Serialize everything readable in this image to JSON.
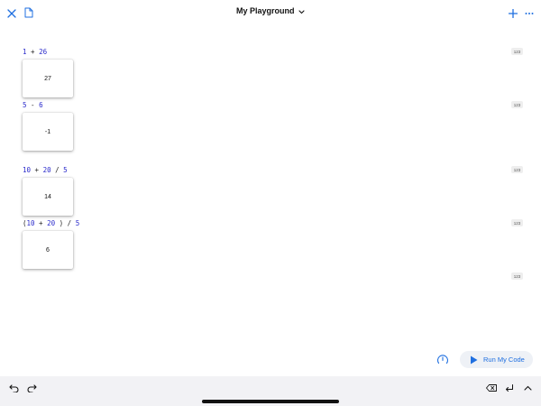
{
  "header": {
    "title": "My Playground"
  },
  "icons": {
    "close": "close-icon",
    "document": "document-icon",
    "chevron": "chevron-down-icon",
    "add": "plus-icon",
    "more": "ellipsis-icon",
    "speed": "speedometer-icon",
    "play": "play-icon",
    "undo": "undo-icon",
    "redo": "redo-icon",
    "delete": "delete-key-icon",
    "return": "return-key-icon",
    "collapse": "chevron-up-icon"
  },
  "code": {
    "lines": [
      {
        "parts": [
          "1",
          " + ",
          "26"
        ],
        "result": "27"
      },
      {
        "parts": [
          "5",
          " - ",
          "6"
        ],
        "result": "-1"
      },
      {
        "parts": [
          "10",
          " + ",
          "20",
          " / ",
          "5"
        ],
        "result": "14"
      },
      {
        "parts": [
          "(",
          "10",
          " + ",
          "20",
          " ) / ",
          "5"
        ],
        "result": "6"
      }
    ]
  },
  "badges": [
    "123",
    "123",
    "123",
    "123",
    "123"
  ],
  "run_button": {
    "label": "Run My Code"
  },
  "colors": {
    "accent": "#1f6fe0",
    "number": "#2a2acb"
  }
}
